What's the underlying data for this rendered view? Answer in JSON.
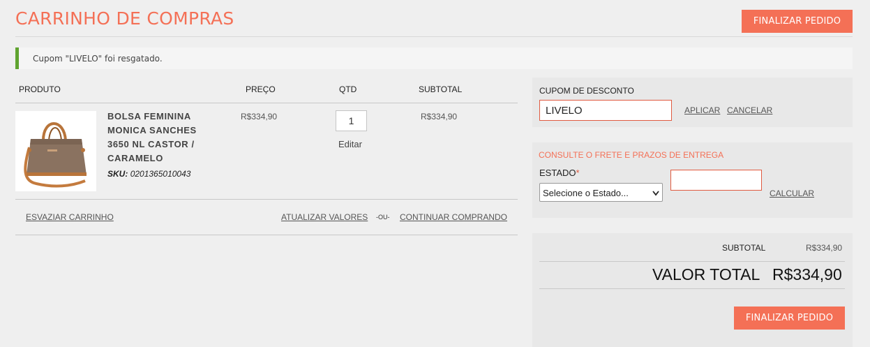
{
  "header": {
    "title": "CARRINHO DE COMPRAS",
    "checkout_label": "FINALIZAR PEDIDO"
  },
  "notice": {
    "text": "Cupom \"LIVELO\" foi resgatado."
  },
  "table": {
    "headers": {
      "product": "PRODUTO",
      "price": "PREÇO",
      "qty": "QTD",
      "subtotal": "SUBTOTAL"
    },
    "items": [
      {
        "name_lines": [
          "BOLSA FEMININA",
          "MONICA SANCHES",
          "3650 NL CASTOR /",
          "CARAMELO"
        ],
        "sku_label": "SKU:",
        "sku": "0201365010043",
        "price": "R$334,90",
        "qty": "1",
        "edit_label": "Editar",
        "subtotal": "R$334,90"
      }
    ]
  },
  "actions": {
    "empty_cart": "ESVAZIAR CARRINHO",
    "update": "ATUALIZAR VALORES",
    "or": "-OU-",
    "continue": "CONTINUAR COMPRANDO"
  },
  "coupon": {
    "label": "CUPOM DE DESCONTO",
    "value": "LIVELO",
    "apply": "APLICAR",
    "cancel": "CANCELAR"
  },
  "shipping": {
    "title": "CONSULTE O FRETE E PRAZOS DE ENTREGA",
    "state_label": "ESTADO",
    "required_mark": "*",
    "state_selected": "Selecione o Estado...",
    "zip_value": "",
    "calculate": "CALCULAR"
  },
  "totals": {
    "subtotal_label": "SUBTOTAL",
    "subtotal_value": "R$334,90",
    "total_label": "VALOR TOTAL",
    "total_value": "R$334,90",
    "checkout_label": "FINALIZAR PEDIDO"
  },
  "colors": {
    "accent": "#f47056",
    "success": "#5fa32f",
    "background": "#efefef"
  },
  "icons": {
    "select_arrow": "chevron-down-icon"
  }
}
